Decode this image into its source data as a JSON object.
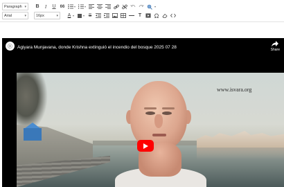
{
  "toolbar": {
    "block_format": "Paragraph",
    "font_family": "Arial",
    "font_size": "16px",
    "bold_label": "B",
    "italic_label": "I",
    "underline_label": "U",
    "strike_label": "S",
    "quote_label": "66",
    "font_color_label": "A",
    "font_icon_label": "T"
  },
  "video": {
    "title": "Agiyara Munjavana, donde Krishna extinguió el incendio del bosque 2025 07 28",
    "share_label": "Share",
    "watermark": "www.isvara.org"
  },
  "colors": {
    "play_button": "#ff0000",
    "video_background": "#000000",
    "toolbar_icon": "#444444"
  }
}
